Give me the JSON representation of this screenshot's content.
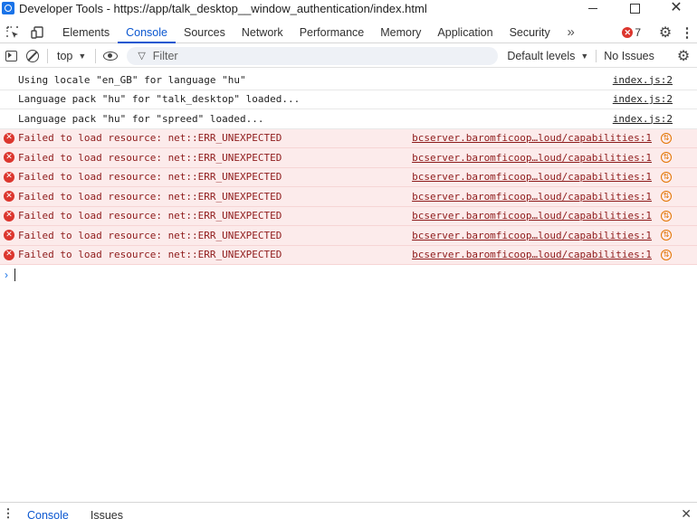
{
  "window": {
    "title": "Developer Tools - https://app/talk_desktop__window_authentication/index.html",
    "close": "✕"
  },
  "tabbar": {
    "tabs": [
      {
        "label": "Elements"
      },
      {
        "label": "Console",
        "active": true
      },
      {
        "label": "Sources"
      },
      {
        "label": "Network"
      },
      {
        "label": "Performance"
      },
      {
        "label": "Memory"
      },
      {
        "label": "Application"
      },
      {
        "label": "Security"
      }
    ],
    "more": "»",
    "error_count": "7",
    "icons": [
      "inspect-icon",
      "device-toolbar-icon",
      "gear-icon",
      "kebab-menu-icon"
    ]
  },
  "toolbar": {
    "context": "top",
    "filter_placeholder": "Filter",
    "levels": "Default levels",
    "issues": "No Issues"
  },
  "messages": [
    {
      "level": "info",
      "text": "Using locale \"en_GB\" for language \"hu\"",
      "source": "index.js:2"
    },
    {
      "level": "info",
      "text": "Language pack \"hu\" for \"talk_desktop\" loaded...",
      "source": "index.js:2"
    },
    {
      "level": "info",
      "text": "Language pack \"hu\" for \"spreed\" loaded...",
      "source": "index.js:2"
    },
    {
      "level": "error",
      "text": "Failed to load resource: net::ERR_UNEXPECTED",
      "source": "bcserver.baromficoop…loud/capabilities:1"
    },
    {
      "level": "error",
      "text": "Failed to load resource: net::ERR_UNEXPECTED",
      "source": "bcserver.baromficoop…loud/capabilities:1"
    },
    {
      "level": "error",
      "text": "Failed to load resource: net::ERR_UNEXPECTED",
      "source": "bcserver.baromficoop…loud/capabilities:1"
    },
    {
      "level": "error",
      "text": "Failed to load resource: net::ERR_UNEXPECTED",
      "source": "bcserver.baromficoop…loud/capabilities:1"
    },
    {
      "level": "error",
      "text": "Failed to load resource: net::ERR_UNEXPECTED",
      "source": "bcserver.baromficoop…loud/capabilities:1"
    },
    {
      "level": "error",
      "text": "Failed to load resource: net::ERR_UNEXPECTED",
      "source": "bcserver.baromficoop…loud/capabilities:1"
    },
    {
      "level": "error",
      "text": "Failed to load resource: net::ERR_UNEXPECTED",
      "source": "bcserver.baromficoop…loud/capabilities:1"
    }
  ],
  "drawer": {
    "tabs": [
      {
        "label": "Console",
        "active": true
      },
      {
        "label": "Issues"
      }
    ],
    "close": "✕"
  },
  "colors": {
    "accent": "#0b57d0",
    "error_bg": "#fcebeb",
    "error_text": "#8e1b1b",
    "error_badge": "#dc362e"
  }
}
